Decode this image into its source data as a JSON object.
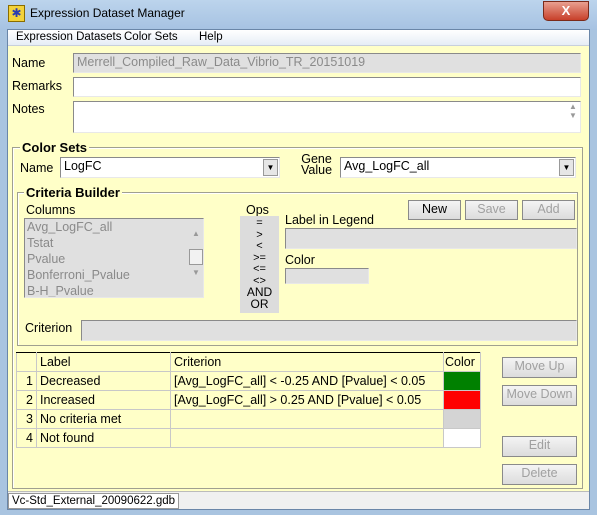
{
  "window": {
    "title": "Expression Dataset Manager",
    "close_label": "X"
  },
  "menu": [
    "Expression Datasets",
    "Color Sets",
    "Help"
  ],
  "dataset": {
    "name_label": "Name",
    "name_value": "Merrell_Compiled_Raw_Data_Vibrio_TR_20151019",
    "remarks_label": "Remarks",
    "remarks_value": "",
    "notes_label": "Notes",
    "notes_value": ""
  },
  "color_sets": {
    "title": "Color Sets",
    "name_label": "Name",
    "name_value": "LogFC",
    "gene_value_label_1": "Gene",
    "gene_value_label_2": "Value",
    "gene_value": "Avg_LogFC_all"
  },
  "criteria_builder": {
    "title": "Criteria Builder",
    "columns_label": "Columns",
    "columns": [
      "Avg_LogFC_all",
      "Tstat",
      "Pvalue",
      "Bonferroni_Pvalue",
      "B-H_Pvalue"
    ],
    "ops_label": "Ops",
    "ops": [
      "=",
      ">",
      "<",
      ">=",
      "<=",
      "<>",
      "AND",
      "OR"
    ],
    "new_label": "New",
    "save_label": "Save",
    "add_label": "Add",
    "legend_label": "Label in Legend",
    "color_label": "Color",
    "criterion_label": "Criterion"
  },
  "table": {
    "headers": [
      "",
      "Label",
      "Criterion",
      "Color"
    ],
    "rows": [
      {
        "index": "1",
        "label": "Decreased",
        "criterion": "[Avg_LogFC_all] < -0.25 AND [Pvalue] < 0.05",
        "color": "#008000"
      },
      {
        "index": "2",
        "label": "Increased",
        "criterion": "[Avg_LogFC_all]  > 0.25 AND [Pvalue] < 0.05",
        "color": "#ff0000"
      },
      {
        "index": "3",
        "label": "No criteria met",
        "criterion": "",
        "color": "#d4d4d4"
      },
      {
        "index": "4",
        "label": "Not found",
        "criterion": "",
        "color": "#ffffff"
      }
    ]
  },
  "side_buttons": {
    "move_up": "Move Up",
    "move_down": "Move Down",
    "edit": "Edit",
    "delete": "Delete"
  },
  "status": "Vc-Std_External_20090622.gdb"
}
